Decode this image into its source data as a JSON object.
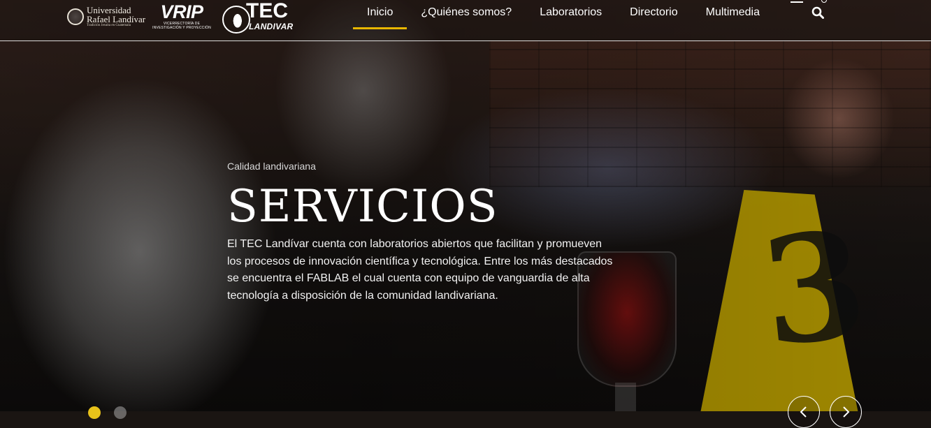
{
  "header": {
    "logos": {
      "url": {
        "line1": "Universidad",
        "line2": "Rafael Landívar",
        "tagline": "Tradición Jesuita en Guatemala"
      },
      "vrip": {
        "word": "VRIP",
        "subtitle": "VICERRECTORÍA DE INVESTIGACIÓN Y PROYECCIÓN"
      },
      "tec": {
        "word": "TEC",
        "subtitle": "LANDIVAR"
      }
    },
    "nav": [
      {
        "label": "Inicio",
        "active": true
      },
      {
        "label": "¿Quiénes somos?",
        "active": false
      },
      {
        "label": "Laboratorios",
        "active": false
      },
      {
        "label": "Directorio",
        "active": false
      },
      {
        "label": "Multimedia",
        "active": false
      }
    ],
    "icons": {
      "search": "search-icon"
    },
    "accent_color": "#e8b600"
  },
  "hero": {
    "kicker": "Calidad landivariana",
    "title": "SERVICIOS",
    "description": "El TEC Landívar cuenta con  laboratorios abiertos que facilitan y promueven los procesos de innovación científica y tecnológica. Entre los más destacados se encuentra el FABLAB el cual cuenta con equipo de vanguardia de alta tecnología a disposición de la comunidad landivariana.",
    "evidence_marker": "3",
    "carousel": {
      "active_dot_color": "#e8c21a",
      "prev_icon": "chevron-left-icon",
      "next_icon": "chevron-right-icon"
    }
  }
}
